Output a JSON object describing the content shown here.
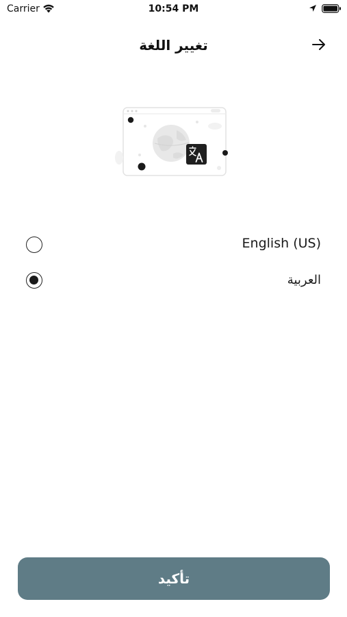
{
  "status_bar": {
    "carrier": "Carrier",
    "time": "10:54 PM",
    "icons": [
      "wifi-icon",
      "location-arrow-icon",
      "battery-icon"
    ]
  },
  "header": {
    "title": "تغيير اللغة",
    "back_icon": "arrow-right-icon"
  },
  "illustration": {
    "icon": "translate-icon",
    "description_icon": "browser-globe-illustration"
  },
  "languages": [
    {
      "label": "English (US)",
      "selected": false
    },
    {
      "label": "العربية",
      "selected": true
    }
  ],
  "confirm_button": {
    "label": "تأكيد"
  },
  "colors": {
    "accent": "#5f7c86",
    "text": "#111111",
    "background": "#ffffff"
  }
}
